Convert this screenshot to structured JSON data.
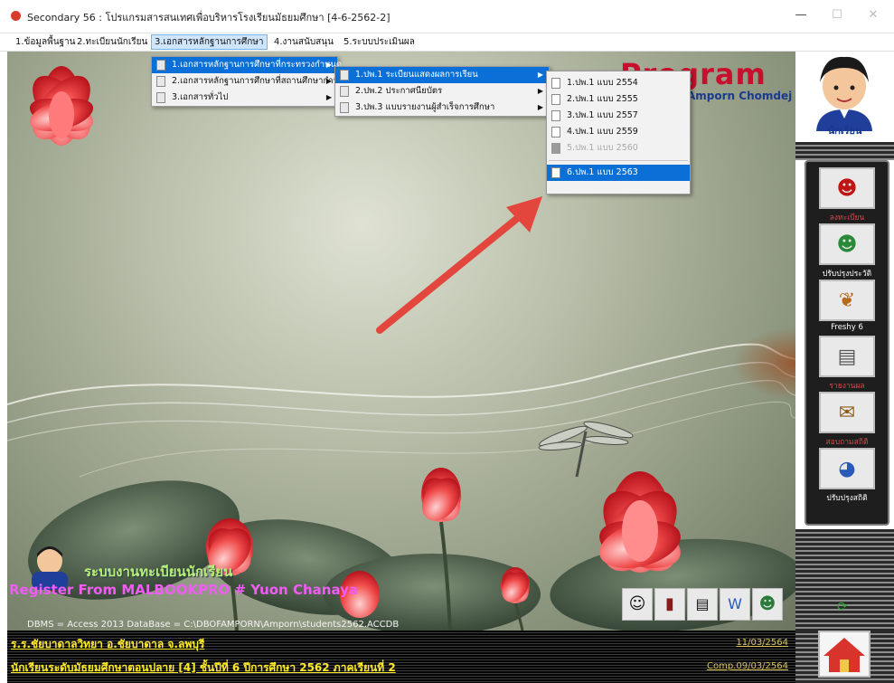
{
  "window": {
    "title": "Secondary 56 : โปรแกรมสารสนเทศเพื่อบริหารโรงเรียนมัธยมศึกษา [4-6-2562-2]",
    "minimize": "—",
    "maximize": "☐",
    "close": "✕"
  },
  "menubar": [
    {
      "label": "1.ข้อมูลพื้นฐาน"
    },
    {
      "label": "2.ทะเบียนนักเรียน"
    },
    {
      "label": "3.เอกสารหลักฐานการศึกษา"
    },
    {
      "label": "4.งานสนับสนุน"
    },
    {
      "label": "5.ระบบประเมินผล"
    }
  ],
  "menu1": [
    {
      "label": "1.เอกสารหลักฐานการศึกษาที่กระทรวงกำหนด"
    },
    {
      "label": "2.เอกสารหลักฐานการศึกษาที่สถานศึกษากำหนด"
    },
    {
      "label": "3.เอกสารทั่วไป"
    }
  ],
  "menu2": [
    {
      "label": "1.ปพ.1 ระเบียนแสดงผลการเรียน"
    },
    {
      "label": "2.ปพ.2 ประกาศนียบัตร"
    },
    {
      "label": "3.ปพ.3 แบบรายงานผู้สำเร็จการศึกษา"
    }
  ],
  "menu3": [
    {
      "label": "1.ปพ.1 แบบ 2554"
    },
    {
      "label": "2.ปพ.1 แบบ 2555"
    },
    {
      "label": "3.ปพ.1 แบบ 2557"
    },
    {
      "label": "4.ปพ.1 แบบ 2559"
    },
    {
      "label": "5.ปพ.1 แบบ 2560"
    },
    {
      "label": "6.ปพ.1 แบบ 2563"
    }
  ],
  "brand": {
    "program_text": "Program",
    "author": "Amporn Chomdej"
  },
  "overlay": {
    "system_title": "ระบบงานทะเบียนนักเรียน",
    "register_line": "Register From MALBOOKPRO # Yuon Chanaya",
    "dbms_line": "DBMS = Access 2013   DataBase = C:\\DBOFAMPORN\\Amporn\\students2562.ACCDB"
  },
  "right_panel": {
    "title": "นักเรียน",
    "tools": [
      {
        "label": "ลงทะเบียน",
        "icon": "student-red-icon"
      },
      {
        "label": "ปรับปรุงประวัติ",
        "icon": "student-green-icon"
      },
      {
        "label": "Freshy 6",
        "icon": "butterfly-icon"
      },
      {
        "label": "รายงานผล",
        "icon": "document-icon"
      },
      {
        "label": "สอบถามสถิติ",
        "icon": "certificate-icon"
      },
      {
        "label": "ปรับปรุงสถิติ",
        "icon": "chart-icon"
      }
    ]
  },
  "status": {
    "school": "ร.ร.ชัยบาดาลวิทยา  อ.ชัยบาดาล  จ.ลพบุรี",
    "level": "นักเรียนระดับมัธยมศึกษาตอนปลาย [4]  ชั้นปีที่ 6  ปีการศึกษา 2562  ภาคเรียนที่ 2",
    "date": "11/03/2564",
    "comp": "Comp.09/03/2564"
  },
  "colors": {
    "selection": "#0a6fd6",
    "status_text": "#ffeb2a",
    "program_red": "#c8102e",
    "author_blue": "#1a3a8e"
  }
}
